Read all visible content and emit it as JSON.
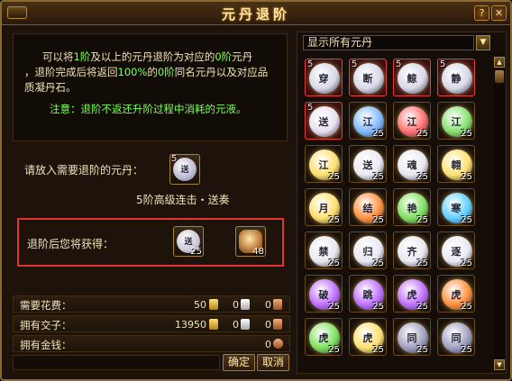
{
  "window": {
    "title": "元丹退阶",
    "help_label": "?",
    "close_label": "✕"
  },
  "info": {
    "line1_a": "可以将",
    "line1_b": "1阶",
    "line1_c": "及以上的元丹退阶为对应的",
    "line1_d": "0阶",
    "line1_e": "元丹",
    "line2_a": "，退阶完成后将返回",
    "line2_b": "100%",
    "line2_c": "的",
    "line2_d": "0阶",
    "line2_e": "同名元丹以及对应品",
    "line3": "质凝丹石。",
    "note": "注意：退阶不返还升阶过程中消耗的元液。"
  },
  "source": {
    "label": "请放入需要退阶的元丹：",
    "slot_tier": "5",
    "slot_glyph": "送",
    "caption": "5阶高级连击・送奏"
  },
  "reward": {
    "label": "退阶后您将获得：",
    "item1_glyph": "送",
    "item1_count": "25",
    "item2_count": "48"
  },
  "costs": {
    "cost_label": "需要花费：",
    "cost_gold": "50",
    "cost_silver": "0",
    "cost_copper": "0",
    "own_label": "拥有交子：",
    "own_gold": "13950",
    "own_silver": "0",
    "own_copper": "0",
    "money_label": "拥有金钱：",
    "money_value": "0"
  },
  "buttons": {
    "confirm": "确定",
    "cancel": "取消"
  },
  "filter": {
    "selected": "显示所有元丹",
    "arrow": "▼"
  },
  "scroll": {
    "up": "▲",
    "down": "▼"
  },
  "inventory": [
    {
      "glyph": "穿",
      "count": "",
      "tier": "5",
      "color": "#d8d8e8"
    },
    {
      "glyph": "断",
      "count": "",
      "tier": "5",
      "color": "#d8d8e8"
    },
    {
      "glyph": "鲸",
      "count": "",
      "tier": "5",
      "color": "#d8d8e8"
    },
    {
      "glyph": "静",
      "count": "",
      "tier": "5",
      "color": "#d8d8e8"
    },
    {
      "glyph": "送",
      "count": "",
      "tier": "5",
      "color": "#e8e0f0"
    },
    {
      "glyph": "江",
      "count": "25",
      "tier": "",
      "color": "#7fb8ff"
    },
    {
      "glyph": "江",
      "count": "25",
      "tier": "",
      "color": "#ff7070"
    },
    {
      "glyph": "江",
      "count": "25",
      "tier": "",
      "color": "#88e070"
    },
    {
      "glyph": "江",
      "count": "25",
      "tier": "",
      "color": "#ffe070"
    },
    {
      "glyph": "送",
      "count": "25",
      "tier": "",
      "color": "#e8e8f0"
    },
    {
      "glyph": "魂",
      "count": "25",
      "tier": "",
      "color": "#e8e8f0"
    },
    {
      "glyph": "翱",
      "count": "25",
      "tier": "",
      "color": "#ffe070"
    },
    {
      "glyph": "月",
      "count": "25",
      "tier": "",
      "color": "#ffe070"
    },
    {
      "glyph": "结",
      "count": "25",
      "tier": "",
      "color": "#ff9040"
    },
    {
      "glyph": "艳",
      "count": "25",
      "tier": "",
      "color": "#80e060"
    },
    {
      "glyph": "寒",
      "count": "25",
      "tier": "",
      "color": "#60d0ff"
    },
    {
      "glyph": "禁",
      "count": "25",
      "tier": "",
      "color": "#e8e8f0"
    },
    {
      "glyph": "归",
      "count": "25",
      "tier": "",
      "color": "#e8e8f0"
    },
    {
      "glyph": "齐",
      "count": "25",
      "tier": "",
      "color": "#e8e8f0"
    },
    {
      "glyph": "逐",
      "count": "25",
      "tier": "",
      "color": "#e8e8f0"
    },
    {
      "glyph": "破",
      "count": "25",
      "tier": "",
      "color": "#c070ff"
    },
    {
      "glyph": "跳",
      "count": "25",
      "tier": "",
      "color": "#c070ff"
    },
    {
      "glyph": "虎",
      "count": "25",
      "tier": "",
      "color": "#c070ff"
    },
    {
      "glyph": "虎",
      "count": "25",
      "tier": "",
      "color": "#ff9040"
    },
    {
      "glyph": "虎",
      "count": "25",
      "tier": "",
      "color": "#80e060"
    },
    {
      "glyph": "虎",
      "count": "25",
      "tier": "",
      "color": "#ffe070"
    },
    {
      "glyph": "同",
      "count": "25",
      "tier": "",
      "color": "#a0a0c0"
    },
    {
      "glyph": "同",
      "count": "25",
      "tier": "",
      "color": "#a0a0c0"
    }
  ]
}
